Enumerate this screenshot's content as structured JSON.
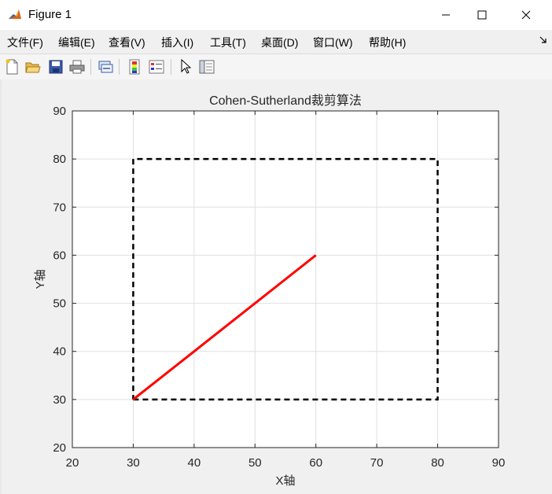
{
  "window": {
    "title": "Figure 1",
    "buttons": [
      "minimize",
      "maximize",
      "close"
    ]
  },
  "menu": {
    "items": [
      "文件(F)",
      "编辑(E)",
      "查看(V)",
      "插入(I)",
      "工具(T)",
      "桌面(D)",
      "窗口(W)",
      "帮助(H)"
    ],
    "corner_icon": "dock-arrow-icon"
  },
  "toolbar": {
    "icons": [
      "new-figure-icon",
      "open-icon",
      "save-icon",
      "print-icon",
      "link-plot-icon",
      "colorbar-icon",
      "legend-icon",
      "pointer-icon",
      "property-inspector-icon"
    ]
  },
  "colors": {
    "line": "#ff0000",
    "clip_window": "#000000",
    "grid": "#e0e0e0",
    "axes_text": "#262626"
  },
  "chart_data": {
    "type": "line",
    "title": "Cohen-Sutherland裁剪算法",
    "xlabel": "X轴",
    "ylabel": "Y轴",
    "xlim": [
      20,
      90
    ],
    "ylim": [
      20,
      90
    ],
    "xticks": [
      20,
      30,
      40,
      50,
      60,
      70,
      80,
      90
    ],
    "yticks": [
      20,
      30,
      40,
      50,
      60,
      70,
      80,
      90
    ],
    "grid": true,
    "series": [
      {
        "style": "dashed",
        "color": "#000000",
        "x": [
          30,
          80,
          80,
          30,
          30
        ],
        "y": [
          30,
          30,
          80,
          80,
          30
        ]
      },
      {
        "style": "solid",
        "color": "#ff0000",
        "x": [
          30,
          60
        ],
        "y": [
          30,
          60
        ]
      }
    ]
  }
}
